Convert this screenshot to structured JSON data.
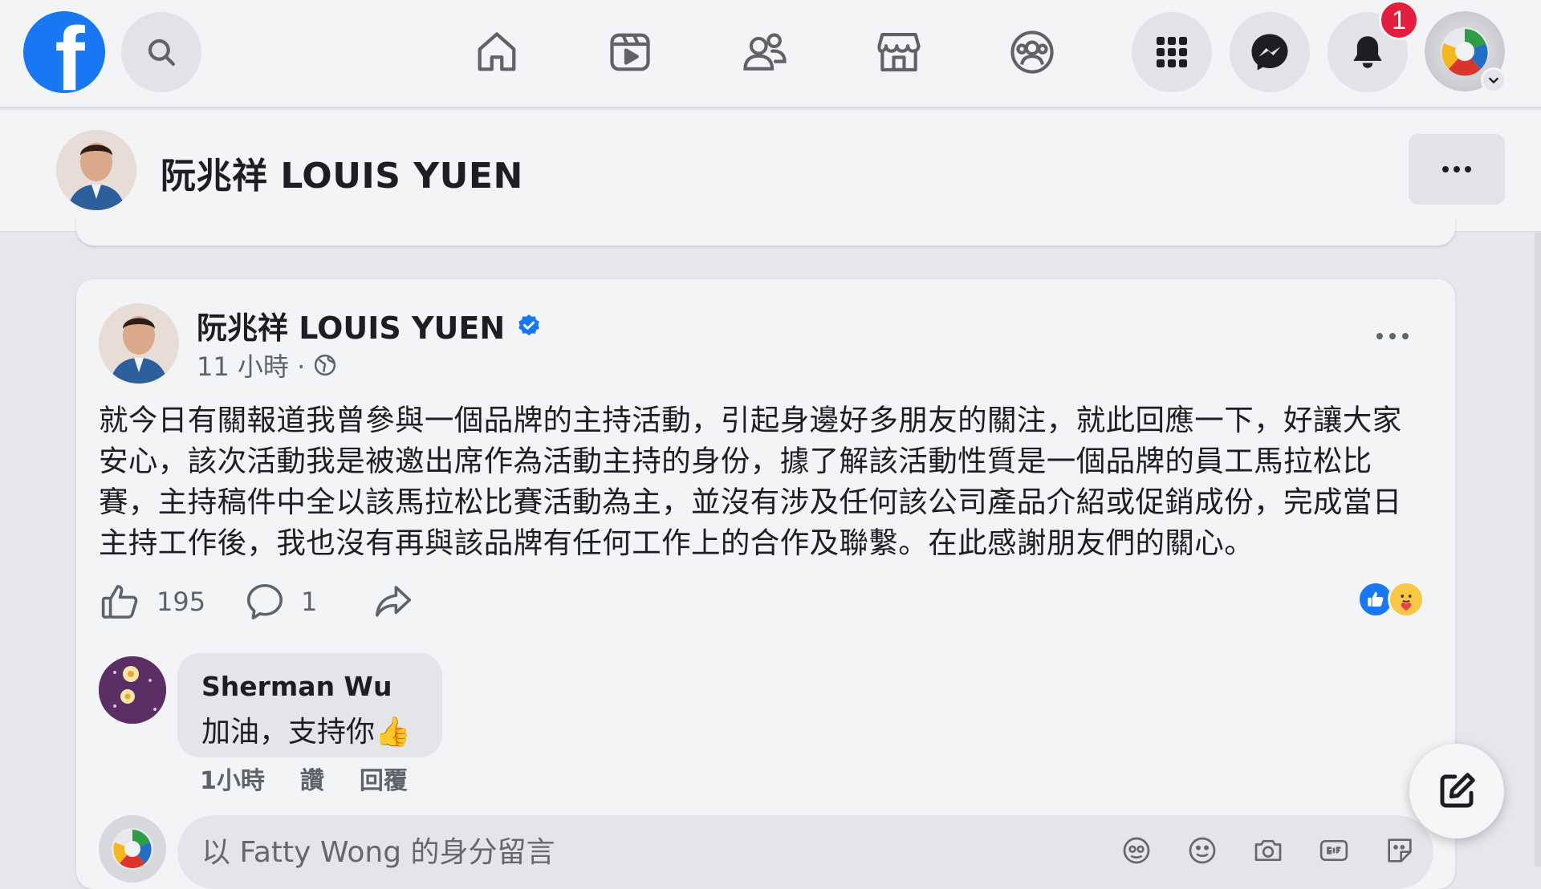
{
  "nav": {
    "logo": "f",
    "notification_count": "1",
    "icons": [
      "search-icon",
      "home-icon",
      "watch-icon",
      "friends-icon",
      "marketplace-icon",
      "groups-icon",
      "menu-grid-icon",
      "messenger-icon",
      "bell-icon"
    ]
  },
  "page": {
    "name": "阮兆祥 LOUIS YUEN"
  },
  "post": {
    "author": "阮兆祥 LOUIS YUEN",
    "time": "11 小時 ·",
    "body": "就今日有關報道我曾參與一個品牌的主持活動，引起身邊好多朋友的關注，就此回應一下，好讓大家安心，該次活動我是被邀出席作為活動主持的身份，據了解該活動性質是一個品牌的員工馬拉松比賽，主持稿件中全以該馬拉松比賽活動為主，並沒有涉及任何該公司產品介紹或促銷成份，完成當日主持工作後，我也沒有再與該品牌有任何工作上的合作及聯繫。在此感謝朋友們的關心。",
    "like_count": "195",
    "comment_count": "1"
  },
  "comment": {
    "author": "Sherman Wu",
    "text": "加油，支持你👍",
    "time": "1小時",
    "like_label": "讚",
    "reply_label": "回覆"
  },
  "composer": {
    "placeholder": "以 Fatty Wong 的身分留言"
  },
  "colors": {
    "brand": "#1877f2",
    "badge": "#e41e3f",
    "verified": "#1877f2"
  }
}
